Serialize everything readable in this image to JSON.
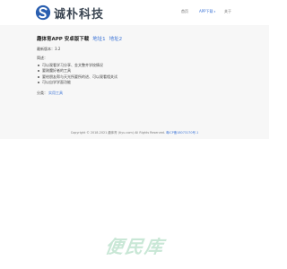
{
  "header": {
    "logo_text": "诚朴科技",
    "nav": {
      "home": "首页",
      "app": "APP下载",
      "about": "关于"
    }
  },
  "main": {
    "app_title": "趣体育APP 安卓版下载",
    "download_links": [
      "地址1",
      "地址2"
    ],
    "version": "最新版本：3.2",
    "intro": "简述：",
    "features": [
      "可以观看学习分享、金文整齐学校情况",
      "要刚魔好者的工具",
      "要给朋友帮与天光所要所的进、可以观看相关试",
      "可以自学学面功能"
    ],
    "category_label": "分类：",
    "category_value": "实用工具"
  },
  "footer": {
    "copyright": "Copyright © 2018-2021 趣体育 (tiyu.com) All Rights Reserved.",
    "icp": "粤ICP备18073170号-1"
  },
  "watermark": "便民库",
  "colors": {
    "accent": "#3b73d6",
    "logo_blue": "#2a5fb0",
    "watermark": "#c9e7d6"
  },
  "icons": {
    "logo": "swirl-s-logo-icon",
    "nav_caret": "chevron-down-icon",
    "bullet": "dot-icon"
  }
}
